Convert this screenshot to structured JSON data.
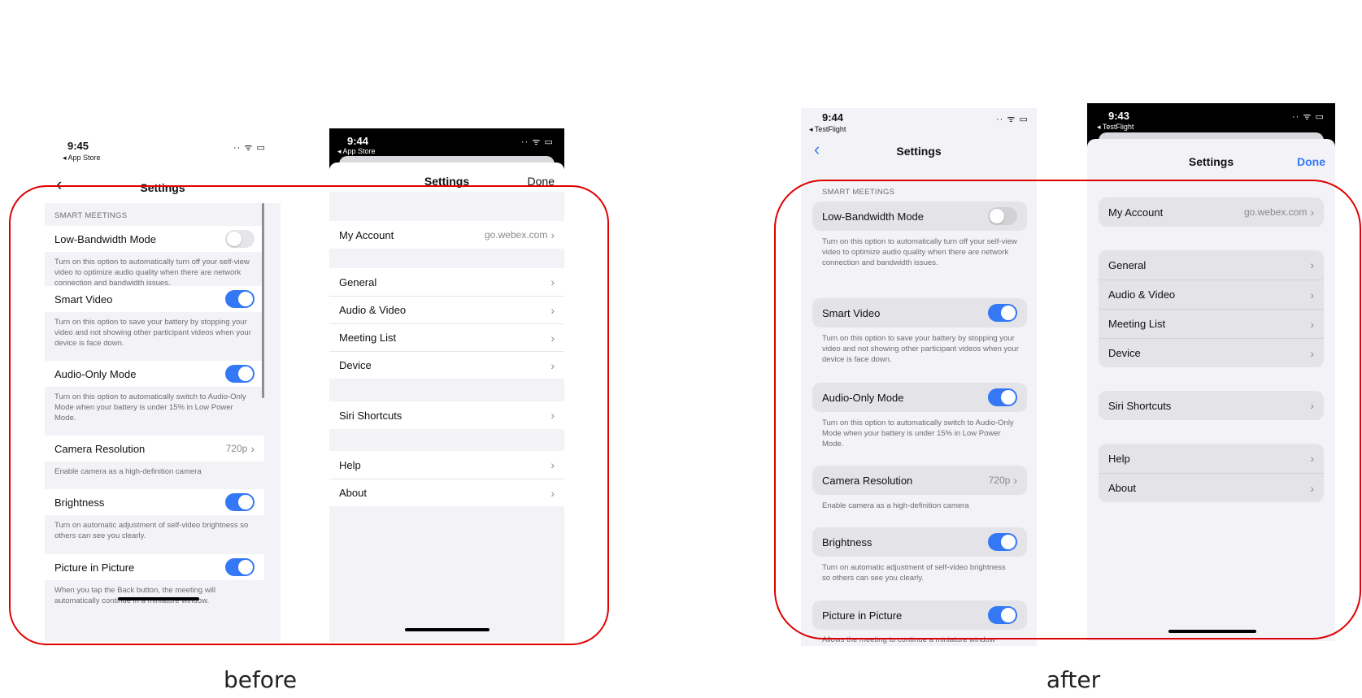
{
  "before": {
    "caption": "before",
    "left_screen": {
      "time": "9:45",
      "back_app": "◂ App Store",
      "status_icons": "·· ᯤ ▭",
      "title": "Settings",
      "back_chevron": "‹",
      "section": "SMART MEETINGS",
      "items": [
        {
          "label": "Low-Bandwidth Mode",
          "toggle": "off",
          "desc": "Turn on this option to automatically turn off your self-view video to optimize audio quality when there are network connection and bandwidth issues."
        },
        {
          "label": "Smart Video",
          "toggle": "on",
          "desc": "Turn on this option to save your battery by stopping your video and not showing other participant videos when your device is face down."
        },
        {
          "label": "Audio-Only Mode",
          "toggle": "on",
          "desc": "Turn on this option to automatically switch to Audio-Only Mode when your battery is under 15% in Low Power Mode."
        },
        {
          "label": "Camera Resolution",
          "value": "720p",
          "desc": "Enable camera as a high-definition camera"
        },
        {
          "label": "Brightness",
          "toggle": "on",
          "desc": "Turn on automatic adjustment of self-video brightness so others can see you clearly."
        },
        {
          "label": "Picture in Picture",
          "toggle": "on",
          "desc": "When you tap the Back button, the meeting will automatically continue in a miniature window."
        }
      ]
    },
    "right_screen": {
      "time": "9:44",
      "back_app": "◂ App Store",
      "status_icons": "·· ᯤ ▭",
      "title": "Settings",
      "done": "Done",
      "account_label": "My Account",
      "account_value": "go.webex.com",
      "group1": [
        "General",
        "Audio & Video",
        "Meeting List",
        "Device"
      ],
      "siri": "Siri Shortcuts",
      "help": "Help",
      "about": "About"
    }
  },
  "after": {
    "caption": "after",
    "left_screen": {
      "time": "9:44",
      "back_app": "◂ TestFlight",
      "status_icons": "·· ᯤ ▭",
      "title": "Settings",
      "back_chevron": "‹",
      "section": "SMART MEETINGS",
      "items": [
        {
          "label": "Low-Bandwidth Mode",
          "toggle": "off",
          "desc": "Turn on this option to automatically turn off your self-view video to optimize audio quality when there are network connection and bandwidth issues."
        },
        {
          "label": "Smart Video",
          "toggle": "on",
          "desc": "Turn on this option to save your battery by stopping your video and not showing other participant videos when your device is face down."
        },
        {
          "label": "Audio-Only Mode",
          "toggle": "on",
          "desc": "Turn on this option to automatically switch to Audio-Only Mode when your battery is under 15% in Low Power Mode."
        },
        {
          "label": "Camera Resolution",
          "value": "720p",
          "desc": "Enable camera as a high-definition camera"
        },
        {
          "label": "Brightness",
          "toggle": "on",
          "desc": "Turn on automatic adjustment of self-video brightness so others can see you clearly."
        },
        {
          "label": "Picture in Picture",
          "toggle": "on",
          "desc": "Allows the meeting to continue a miniature window"
        }
      ]
    },
    "right_screen": {
      "time": "9:43",
      "back_app": "◂ TestFlight",
      "status_icons": "·· ᯤ ▭",
      "title": "Settings",
      "done": "Done",
      "account_label": "My Account",
      "account_value": "go.webex.com",
      "group1": [
        "General",
        "Audio & Video",
        "Meeting List",
        "Device"
      ],
      "siri": "Siri Shortcuts",
      "help": "Help",
      "about": "About"
    }
  },
  "colors": {
    "accent": "#3478f6",
    "highlight_ring": "#e00000",
    "grouped_bg": "#f2f2f7"
  }
}
